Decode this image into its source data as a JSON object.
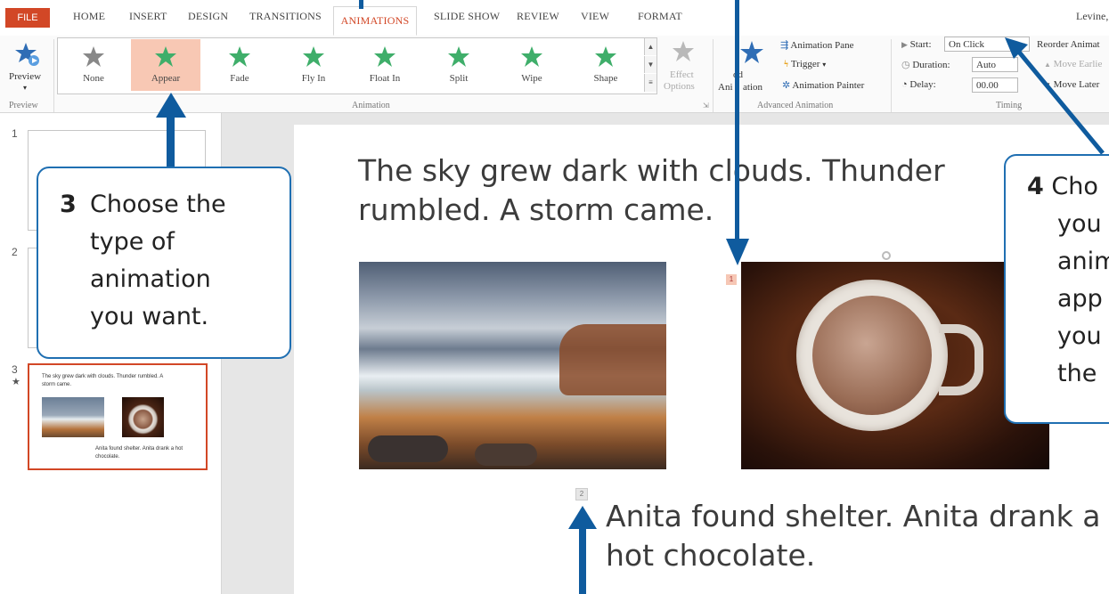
{
  "tabs": {
    "file": "FILE",
    "home": "HOME",
    "insert": "INSERT",
    "design": "DESIGN",
    "transitions": "TRANSITIONS",
    "animations": "ANIMATIONS",
    "slideshow": "SLIDE SHOW",
    "review": "REVIEW",
    "view": "VIEW",
    "format": "FORMAT"
  },
  "user": "Levine,",
  "ribbon": {
    "preview_label": "Preview",
    "preview_group": "Preview",
    "animation_group": "Animation",
    "animations": [
      "None",
      "Appear",
      "Fade",
      "Fly In",
      "Float In",
      "Split",
      "Wipe",
      "Shape"
    ],
    "selected_animation": "Appear",
    "effect_options_1": "Effect",
    "effect_options_2": "Options",
    "add_animation_1": "dd",
    "add_animation_2": "Ani",
    "add_animation_3": "ation",
    "animation_pane": "Animation Pane",
    "trigger": "Trigger",
    "animation_painter": "Animation Painter",
    "advanced_group": "Advanced Animation",
    "start_label": "Start:",
    "start_value": "On Click",
    "duration_label": "Duration:",
    "duration_value": "Auto",
    "delay_label": "Delay:",
    "delay_value": "00.00",
    "timing_group": "Timing",
    "reorder": "Reorder Animat",
    "move_earlier": "Move Earlie",
    "move_later": "Move Later"
  },
  "slides_panel": {
    "numbers": [
      "1",
      "2",
      "3"
    ],
    "thumb3_title": "The sky grew dark with clouds. Thunder rumbled. A storm came.",
    "thumb3_body": "Anita found shelter. Anita drank a hot chocolate."
  },
  "slide": {
    "title": "The sky grew dark with clouds. Thunder rumbled. A storm came.",
    "body": "Anita found shelter. Anita drank a hot chocolate.",
    "tag_image": "1",
    "tag_text": "2"
  },
  "callouts": {
    "step3_num": "3",
    "step3_text": "Choose the type of animation you want.",
    "step4_num": "4",
    "step4_l1": "Cho",
    "step4_l2": "you",
    "step4_l3": "anim",
    "step4_l4": "app",
    "step4_l5": "you",
    "step4_l6": "the"
  },
  "colors": {
    "accent": "#d24726",
    "callout_border": "#1f6fb2",
    "arrow": "#0f5b9e",
    "star": "#3fae6a"
  }
}
